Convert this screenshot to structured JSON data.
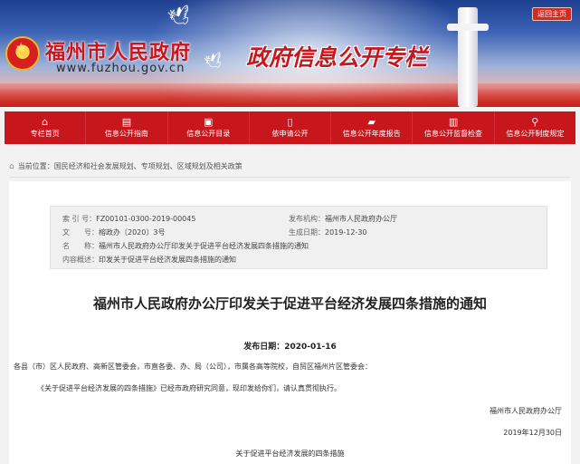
{
  "header": {
    "city_name": "福州市人民政府",
    "url": "www.fuzhou.gov.cn",
    "slogan": "政府信息公开专栏",
    "back_home": "返回主页"
  },
  "nav": [
    {
      "icon": "home-icon",
      "glyph": "⌂",
      "label": "专栏首页"
    },
    {
      "icon": "guide-icon",
      "glyph": "▤",
      "label": "信息公开指南"
    },
    {
      "icon": "catalog-icon",
      "glyph": "▣",
      "label": "信息公开目录"
    },
    {
      "icon": "apply-icon",
      "glyph": "▯",
      "label": "依申请公开"
    },
    {
      "icon": "folder-icon",
      "glyph": "▰",
      "label": "信息公开年度报告"
    },
    {
      "icon": "supervision-icon",
      "glyph": "▥",
      "label": "信息公开监督检查"
    },
    {
      "icon": "key-icon",
      "glyph": "⚲",
      "label": "信息公开制度规定"
    }
  ],
  "breadcrumb": {
    "prefix": "当前位置：",
    "path": "国民经济和社会发展规划、专项规划、区域规划及相关政策"
  },
  "meta": {
    "index_label": "索 引 号：",
    "index_value": "FZ00101-0300-2019-00045",
    "publisher_label": "发布机构：",
    "publisher_value": "福州市人民政府办公厅",
    "doc_no_label": "文　　号：",
    "doc_no_value": "榕政办〔2020〕3号",
    "date_label": "生成日期：",
    "date_value": "2019-12-30",
    "name_label": "名　　称：",
    "name_value": "福州市人民政府办公厅印发关于促进平台经济发展四条措施的通知",
    "summary_label": "内容概述：",
    "summary_value": "印发关于促进平台经济发展四条措施的通知"
  },
  "article": {
    "title": "福州市人民政府办公厅印发关于促进平台经济发展四条措施的通知",
    "publish_date": "发布日期：2020-01-16",
    "addressee": "各县（市）区人民政府、高新区管委会，市直各委、办、局（公司），市属各高等院校，自贸区福州片区管委会：",
    "body": "《关于促进平台经济发展的四条措施》已经市政府研究同意，现印发给你们，请认真贯彻执行。",
    "signature": "福州市人民政府办公厅",
    "sign_date": "2019年12月30日",
    "attachment_title": "关于促进平台经济发展的四条措施"
  }
}
